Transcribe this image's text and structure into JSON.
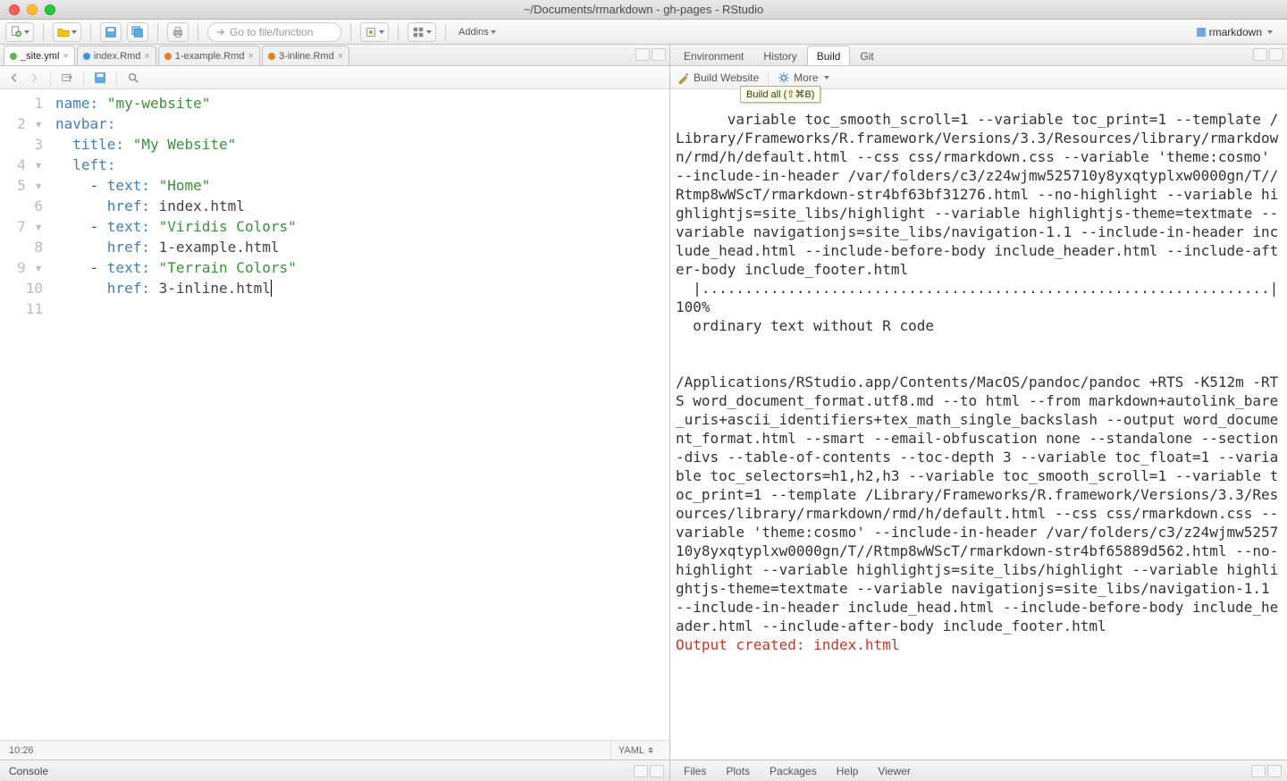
{
  "window": {
    "title": "~/Documents/rmarkdown - gh-pages - RStudio"
  },
  "maintoolbar": {
    "goto_placeholder": "Go to file/function",
    "addins_label": "Addins",
    "project_name": "rmarkdown"
  },
  "editor": {
    "tabs": [
      {
        "label": "_site.yml",
        "active": true,
        "icon": "green"
      },
      {
        "label": "index.Rmd",
        "active": false,
        "icon": "blue"
      },
      {
        "label": "1-example.Rmd",
        "active": false,
        "icon": "rb"
      },
      {
        "label": "3-inline.Rmd",
        "active": false,
        "icon": "rb"
      }
    ],
    "lines": [
      {
        "n": "1",
        "collapse": "",
        "indent": 0,
        "key": "name",
        "val": "\"my-website\""
      },
      {
        "n": "2",
        "collapse": "▾",
        "indent": 0,
        "key": "navbar",
        "val": ""
      },
      {
        "n": "3",
        "collapse": "",
        "indent": 1,
        "key": "title",
        "val": "\"My Website\""
      },
      {
        "n": "4",
        "collapse": "▾",
        "indent": 1,
        "key": "left",
        "val": ""
      },
      {
        "n": "5",
        "collapse": "▾",
        "indent": 2,
        "dash": true,
        "key": "text",
        "val": "\"Home\""
      },
      {
        "n": "6",
        "collapse": "",
        "indent": 3,
        "key": "href",
        "plain": "index.html"
      },
      {
        "n": "7",
        "collapse": "▾",
        "indent": 2,
        "dash": true,
        "key": "text",
        "val": "\"Viridis Colors\""
      },
      {
        "n": "8",
        "collapse": "",
        "indent": 3,
        "key": "href",
        "plain": "1-example.html"
      },
      {
        "n": "9",
        "collapse": "▾",
        "indent": 2,
        "dash": true,
        "key": "text",
        "val": "\"Terrain Colors\""
      },
      {
        "n": "10",
        "collapse": "",
        "indent": 3,
        "key": "href",
        "plain": "3-inline.html",
        "caret": true
      },
      {
        "n": "11",
        "collapse": "",
        "empty": true
      }
    ],
    "status_pos": "10:26",
    "lang": "YAML"
  },
  "leftbottom": {
    "console_label": "Console"
  },
  "right": {
    "top_tabs": [
      "Environment",
      "History",
      "Build",
      "Git"
    ],
    "top_active": "Build",
    "buildbar": {
      "build_label": "Build Website",
      "more_label": "More",
      "tooltip": "Build all (⇧⌘B)"
    },
    "output_pre": "variable toc_smooth_scroll=1 --variable toc_print=1 --template /Library/Frameworks/R.framework/Versions/3.3/Resources/library/rmarkdown/rmd/h/default.html --css css/rmarkdown.css --variable 'theme:cosmo' --include-in-header /var/folders/c3/z24wjmw525710y8yxqtyplxw0000gn/T//Rtmp8wWScT/rmarkdown-str4bf63bf31276.html --no-highlight --variable highlightjs=site_libs/highlight --variable highlightjs-theme=textmate --variable navigationjs=site_libs/navigation-1.1 --include-in-header include_head.html --include-before-body include_header.html --include-after-body include_footer.html\n  |..................................................................| 100%\n  ordinary text without R code\n\n\n/Applications/RStudio.app/Contents/MacOS/pandoc/pandoc +RTS -K512m -RTS word_document_format.utf8.md --to html --from markdown+autolink_bare_uris+ascii_identifiers+tex_math_single_backslash --output word_document_format.html --smart --email-obfuscation none --standalone --section-divs --table-of-contents --toc-depth 3 --variable toc_float=1 --variable toc_selectors=h1,h2,h3 --variable toc_smooth_scroll=1 --variable toc_print=1 --template /Library/Frameworks/R.framework/Versions/3.3/Resources/library/rmarkdown/rmd/h/default.html --css css/rmarkdown.css --variable 'theme:cosmo' --include-in-header /var/folders/c3/z24wjmw525710y8yxqtyplxw0000gn/T//Rtmp8wWScT/rmarkdown-str4bf65889d562.html --no-highlight --variable highlightjs=site_libs/highlight --variable highlightjs-theme=textmate --variable navigationjs=site_libs/navigation-1.1 --include-in-header include_head.html --include-before-body include_header.html --include-after-body include_footer.html\n",
    "output_hl": "Output created: index.html",
    "bottom_tabs": [
      "Files",
      "Plots",
      "Packages",
      "Help",
      "Viewer"
    ]
  }
}
